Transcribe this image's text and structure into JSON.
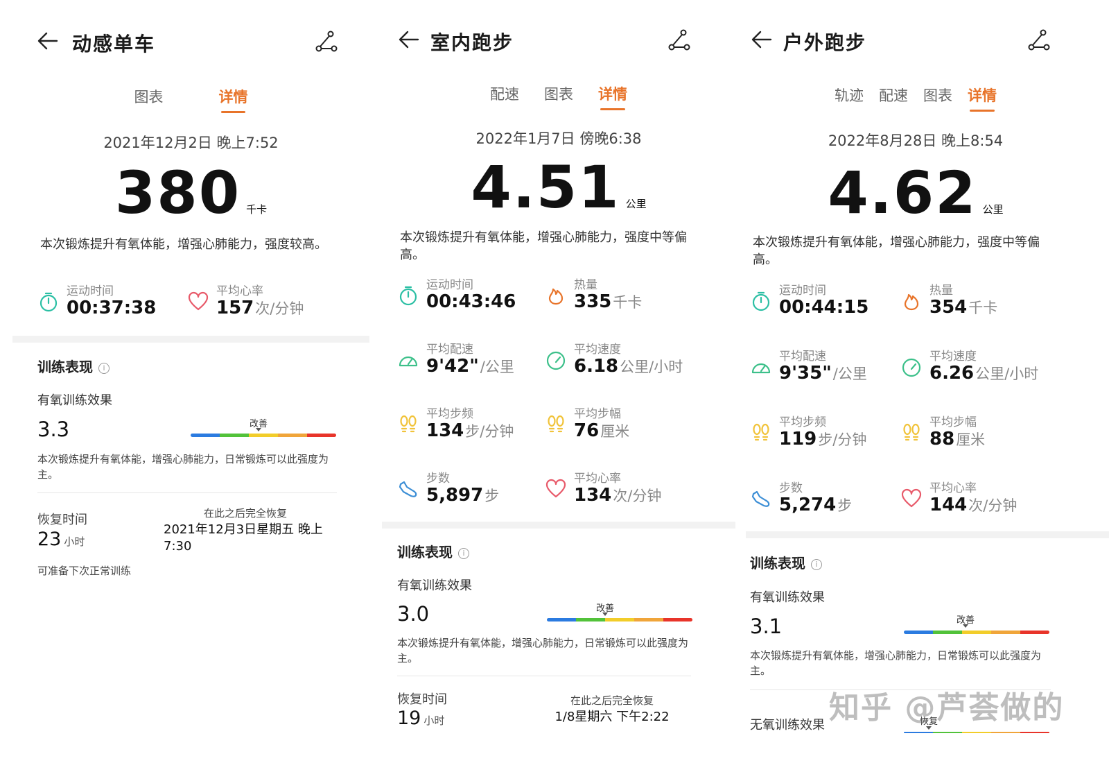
{
  "colors": {
    "accent": "#e8742a",
    "stopwatch": "#2bbfa4",
    "heat": "#e8742a",
    "speed": "#3cc08a",
    "steps": "#f1c33a",
    "shoe": "#3d8fd6",
    "heart": "#e85a6a",
    "intensity": [
      "#2b7be0",
      "#52c23a",
      "#f2cd2a",
      "#f0a53a",
      "#e8342a"
    ]
  },
  "watermark": "知乎 @芦荟做的",
  "panels": [
    {
      "title": "动感单车",
      "tabs": [
        "图表",
        "详情"
      ],
      "date": "2021年12月2日 晚上7:52",
      "main_value": "380",
      "main_unit": "千卡",
      "desc": "本次锻炼提升有氧体能，增强心肺能力，强度较高。",
      "metrics": [
        {
          "icon": "stopwatch-icon",
          "label": "运动时间",
          "value": "00:37:38",
          "unit": ""
        },
        {
          "icon": "heart-icon",
          "label": "平均心率",
          "value": "157",
          "unit": "次/分钟"
        }
      ],
      "training_title": "训练表现",
      "aerobic_label": "有氧训练效果",
      "aerobic_value": "3.3",
      "bar_label": "改善",
      "aerobic_desc": "本次锻炼提升有氧体能，增强心肺能力，日常锻炼可以此强度为主。",
      "recovery_label": "恢复时间",
      "recovery_value": "23",
      "recovery_unit": "小时",
      "recovery_right_label": "在此之后完全恢复",
      "recovery_right_value": "2021年12月3日星期五 晚上7:30",
      "ready_text": "可准备下次正常训练"
    },
    {
      "title": "室内跑步",
      "tabs": [
        "配速",
        "图表",
        "详情"
      ],
      "date": "2022年1月7日 傍晚6:38",
      "main_value": "4.51",
      "main_unit": "公里",
      "desc": "本次锻炼提升有氧体能，增强心肺能力，强度中等偏高。",
      "metrics": [
        {
          "icon": "stopwatch-icon",
          "label": "运动时间",
          "value": "00:43:46",
          "unit": ""
        },
        {
          "icon": "flame-icon",
          "label": "热量",
          "value": "335",
          "unit": "千卡"
        },
        {
          "icon": "speedometer-icon",
          "label": "平均配速",
          "value": "9'42\"",
          "unit": "/公里"
        },
        {
          "icon": "gauge-icon",
          "label": "平均速度",
          "value": "6.18",
          "unit": "公里/小时"
        },
        {
          "icon": "footprints-icon",
          "label": "平均步频",
          "value": "134",
          "unit": "步/分钟"
        },
        {
          "icon": "footprints-icon",
          "label": "平均步幅",
          "value": "76",
          "unit": "厘米"
        },
        {
          "icon": "shoe-icon",
          "label": "步数",
          "value": "5,897",
          "unit": "步"
        },
        {
          "icon": "heart-icon",
          "label": "平均心率",
          "value": "134",
          "unit": "次/分钟"
        }
      ],
      "training_title": "训练表现",
      "aerobic_label": "有氧训练效果",
      "aerobic_value": "3.0",
      "bar_label": "改善",
      "aerobic_desc": "本次锻炼提升有氧体能，增强心肺能力，日常锻炼可以此强度为主。",
      "recovery_label": "恢复时间",
      "recovery_value": "19",
      "recovery_unit": "小时",
      "recovery_right_label": "在此之后完全恢复",
      "recovery_right_value": "1/8星期六 下午2:22"
    },
    {
      "title": "户外跑步",
      "tabs": [
        "轨迹",
        "配速",
        "图表",
        "详情"
      ],
      "date": "2022年8月28日 晚上8:54",
      "main_value": "4.62",
      "main_unit": "公里",
      "desc": "本次锻炼提升有氧体能，增强心肺能力，强度中等偏高。",
      "metrics": [
        {
          "icon": "stopwatch-icon",
          "label": "运动时间",
          "value": "00:44:15",
          "unit": ""
        },
        {
          "icon": "flame-icon",
          "label": "热量",
          "value": "354",
          "unit": "千卡"
        },
        {
          "icon": "speedometer-icon",
          "label": "平均配速",
          "value": "9'35\"",
          "unit": "/公里"
        },
        {
          "icon": "gauge-icon",
          "label": "平均速度",
          "value": "6.26",
          "unit": "公里/小时"
        },
        {
          "icon": "footprints-icon",
          "label": "平均步频",
          "value": "119",
          "unit": "步/分钟"
        },
        {
          "icon": "footprints-icon",
          "label": "平均步幅",
          "value": "88",
          "unit": "厘米"
        },
        {
          "icon": "shoe-icon",
          "label": "步数",
          "value": "5,274",
          "unit": "步"
        },
        {
          "icon": "heart-icon",
          "label": "平均心率",
          "value": "144",
          "unit": "次/分钟"
        }
      ],
      "training_title": "训练表现",
      "aerobic_label": "有氧训练效果",
      "aerobic_value": "3.1",
      "bar_label": "改善",
      "aerobic_desc": "本次锻炼提升有氧体能，增强心肺能力，日常锻炼可以此强度为主。",
      "anaerobic_label": "无氧训练效果",
      "anaerobic_bar_label": "恢复"
    }
  ]
}
